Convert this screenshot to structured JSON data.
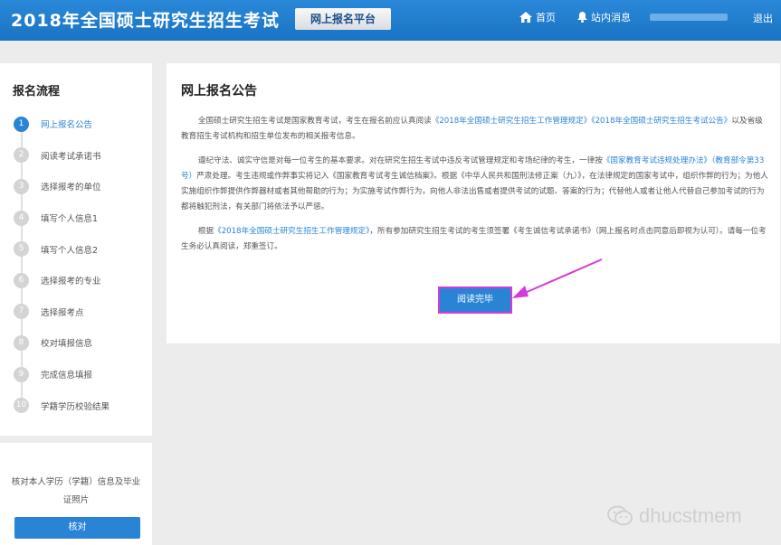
{
  "header": {
    "site_title": "2018年全国硕士研究生招生考试",
    "platform_label": "网上报名平台",
    "nav_home": "首页",
    "nav_messages": "站内消息",
    "logout": "退出"
  },
  "sidebar": {
    "title": "报名流程",
    "steps": [
      {
        "num": "1",
        "label": "网上报名公告",
        "active": true
      },
      {
        "num": "2",
        "label": "阅读考试承诺书"
      },
      {
        "num": "3",
        "label": "选择报考的单位"
      },
      {
        "num": "4",
        "label": "填写个人信息1"
      },
      {
        "num": "5",
        "label": "填写个人信息2"
      },
      {
        "num": "6",
        "label": "选择报考的专业"
      },
      {
        "num": "7",
        "label": "选择报考点"
      },
      {
        "num": "8",
        "label": "校对填报信息"
      },
      {
        "num": "9",
        "label": "完成信息填报"
      },
      {
        "num": "10",
        "label": "学籍学历校验结果"
      }
    ],
    "verify_text": "核对本人学历（学籍）信息及毕业证照片",
    "verify_button": "核对"
  },
  "main": {
    "title": "网上报名公告",
    "p1": {
      "t1": "全国硕士研究生招生考试是国家教育考试，考生在报名前应认真阅读",
      "l1": "《2018年全国硕士研究生招生工作管理规定》",
      "l2": "《2018年全国硕士研究生招生考试公告》",
      "t2": "以及省级教育招生考试机构和招生单位发布的相关报考信息。"
    },
    "p2": {
      "t1": "遵纪守法、诚实守信是对每一位考生的基本要求。对在研究生招生考试中违反考试管理规定和考场纪律的考生，一律按",
      "l1": "《国家教育考试违规处理办法》（教育部令第33号）",
      "t2": "严肃处理。考生违规或作弊事实将记入《国家教育考试考生诚信档案》。根据《中华人民共和国刑法修正案（九）》，在法律规定的国家考试中，组织作弊的行为；为他人实施组织作弊提供作弊器材或者其他帮助的行为；为实施考试作弊行为，向他人非法出售或者提供考试的试题、答案的行为；代替他人或者让他人代替自己参加考试的行为都将触犯刑法，有关部门将依法予以严惩。"
    },
    "p3": {
      "t1": "根据",
      "l1": "《2018年全国硕士研究生招生工作管理规定》",
      "t2": "，所有参加研究生招生考试的考生须签署《考生诚信考试承诺书》（网上报名时点击同意后即视为认可）。请每一位考生务必认真阅读，郑重签订。"
    },
    "read_button": "阅读完毕"
  },
  "watermark": "dhucstmem"
}
